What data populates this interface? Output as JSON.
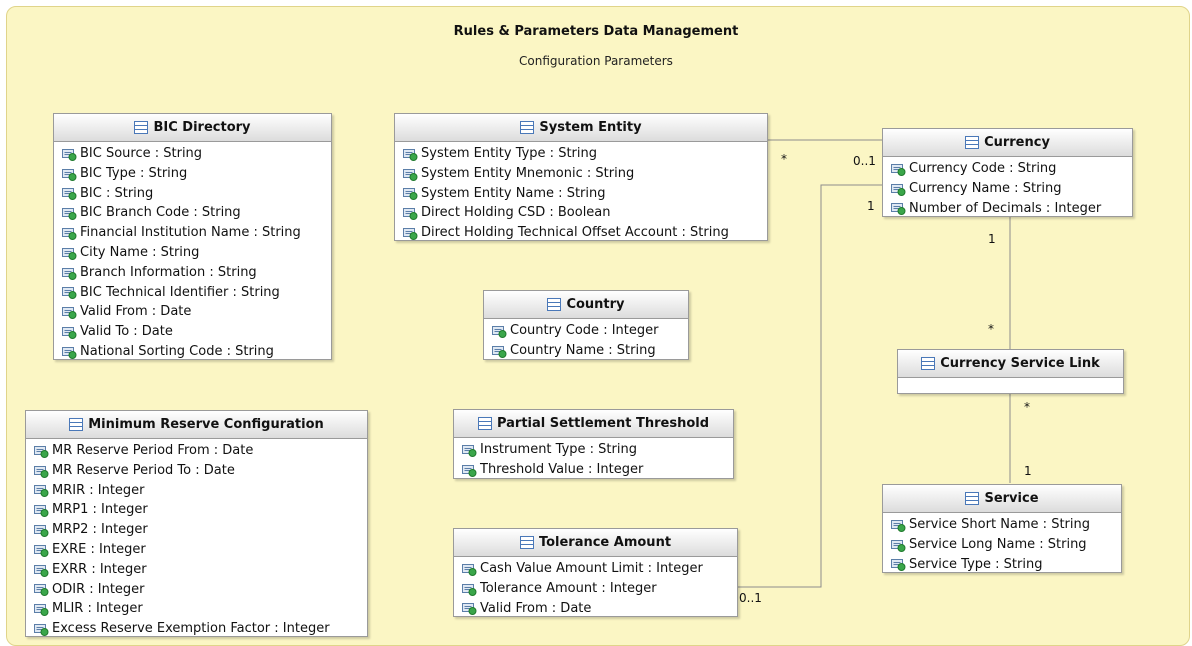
{
  "package": {
    "title": "Rules & Parameters Data Management",
    "subtitle": "Configuration Parameters"
  },
  "classes": {
    "bic_directory": {
      "name": "BIC Directory",
      "attributes": [
        "BIC Source : String",
        "BIC Type : String",
        "BIC : String",
        "BIC Branch Code : String",
        "Financial Institution Name : String",
        "City Name : String",
        "Branch Information : String",
        "BIC Technical Identifier : String",
        "Valid From : Date",
        "Valid To : Date",
        "National Sorting Code : String"
      ]
    },
    "system_entity": {
      "name": "System Entity",
      "attributes": [
        "System Entity Type : String",
        "System Entity Mnemonic : String",
        "System Entity Name : String",
        "Direct Holding CSD : Boolean",
        "Direct Holding Technical Offset Account : String"
      ]
    },
    "currency": {
      "name": "Currency",
      "attributes": [
        "Currency Code : String",
        "Currency Name : String",
        "Number of Decimals : Integer"
      ]
    },
    "country": {
      "name": "Country",
      "attributes": [
        "Country Code : Integer",
        "Country Name : String"
      ]
    },
    "currency_service_link": {
      "name": "Currency Service Link",
      "attributes": []
    },
    "minimum_reserve": {
      "name": "Minimum Reserve Configuration",
      "attributes": [
        "MR Reserve Period From : Date",
        "MR Reserve Period To : Date",
        "MRIR : Integer",
        "MRP1 : Integer",
        "MRP2 : Integer",
        "EXRE : Integer",
        "EXRR : Integer",
        "ODIR : Integer",
        "MLIR : Integer",
        "Excess Reserve Exemption Factor : Integer"
      ]
    },
    "partial_settlement": {
      "name": "Partial Settlement Threshold",
      "attributes": [
        "Instrument Type : String",
        "Threshold Value : Integer"
      ]
    },
    "tolerance_amount": {
      "name": "Tolerance Amount",
      "attributes": [
        "Cash Value Amount Limit : Integer",
        "Tolerance Amount : Integer",
        "Valid From : Date"
      ]
    },
    "service": {
      "name": "Service",
      "attributes": [
        "Service Short Name : String",
        "Service Long Name : String",
        "Service Type : String"
      ]
    }
  },
  "associations": [
    {
      "from": "System Entity",
      "from_mult": "*",
      "to": "Currency",
      "to_mult": "0..1"
    },
    {
      "from": "Tolerance Amount",
      "from_mult": "0..1",
      "to": "Currency",
      "to_mult": "1"
    },
    {
      "from": "Currency",
      "from_mult": "1",
      "to": "Currency Service Link",
      "to_mult": "*"
    },
    {
      "from": "Currency Service Link",
      "from_mult": "*",
      "to": "Service",
      "to_mult": "1"
    }
  ],
  "icons": {
    "class": "class-icon",
    "attribute": "attribute-icon"
  },
  "colors": {
    "package_fill": "#fbf6c4",
    "package_border": "#e0d48a",
    "line": "#8c8c8c",
    "attr_icon_green": "#3aa64a",
    "class_icon_blue": "#4a78b8"
  }
}
